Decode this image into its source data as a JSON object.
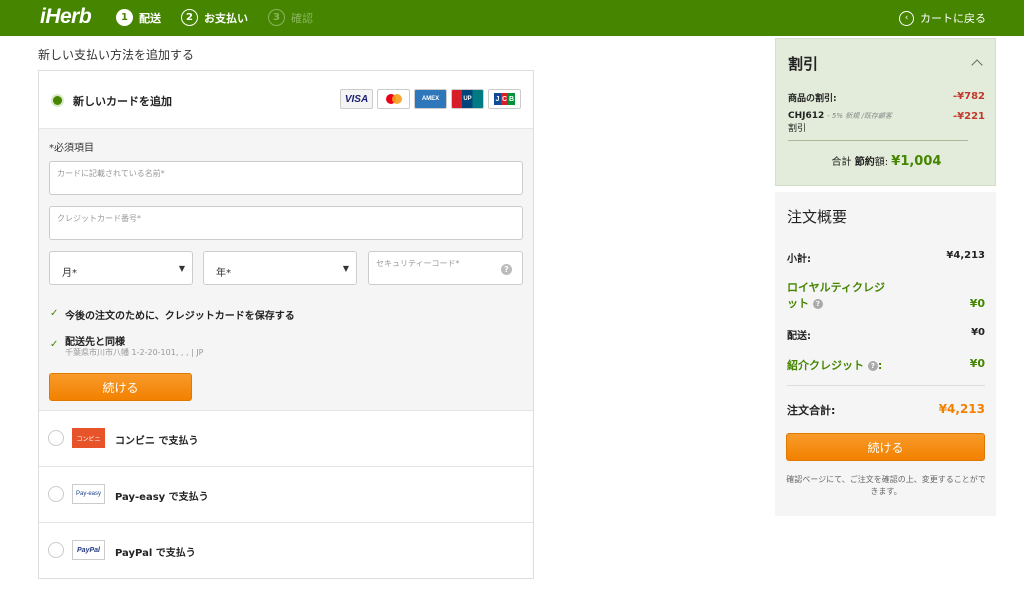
{
  "header": {
    "logo": "iHerb",
    "steps": [
      {
        "num": "1",
        "label": "配送"
      },
      {
        "num": "2",
        "label": "お支払い"
      },
      {
        "num": "3",
        "label": "確認"
      }
    ],
    "back_label": "カートに戻る"
  },
  "payment": {
    "section_title": "新しい支払い方法を追加する",
    "new_card_label": "新しいカードを追加",
    "card_brands": [
      "VISA",
      "Mastercard",
      "AMERICAN EXPRESS",
      "UnionPay",
      "JCB"
    ],
    "required_note": "*必須項目",
    "name_placeholder": "カードに記載されている名前*",
    "number_placeholder": "クレジットカード番号*",
    "month_label": "月*",
    "year_label": "年*",
    "cvv_placeholder": "セキュリティーコード*",
    "save_card_label": "今後の注文のために、クレジットカードを保存する",
    "same_address_label": "配送先と同様",
    "same_address_sub": "千葉県市川市八幡 1-2-20-101, , , | JP",
    "continue_label": "続ける",
    "alternatives": [
      {
        "logo": "コンビニ",
        "label": "コンビニ で支払う"
      },
      {
        "logo": "Pay-easy",
        "label": "Pay-easy で支払う"
      },
      {
        "logo": "PayPal",
        "label": "PayPal で支払う"
      }
    ]
  },
  "discount": {
    "title": "割引",
    "product_label": "商品の割引:",
    "product_value": "-¥782",
    "code_label": "CHJ612",
    "code_sub": "- 5% 新規 /既存顧客",
    "code_sub2": "割引",
    "code_value": "-¥221",
    "total_prefix": "合計",
    "total_bold": "節約",
    "total_suffix": "額:",
    "total_value": "¥1,004"
  },
  "summary": {
    "title": "注文概要",
    "subtotal_label": "小計:",
    "subtotal_value": "¥4,213",
    "loyalty_label_1": "ロイヤルティクレジ",
    "loyalty_label_2": "ット",
    "loyalty_value": "¥0",
    "shipping_label": "配送:",
    "shipping_value": "¥0",
    "referral_label": "紹介クレジット",
    "referral_colon": ":",
    "referral_value": "¥0",
    "total_label": "注文合計:",
    "total_value": "¥4,213",
    "continue_label": "続ける",
    "note": "確認ページにて、ご注文を確認の上、変更することができます。"
  },
  "colors": {
    "brand_green": "#458500",
    "accent_orange": "#f28100",
    "discount_red": "#c0392b"
  }
}
